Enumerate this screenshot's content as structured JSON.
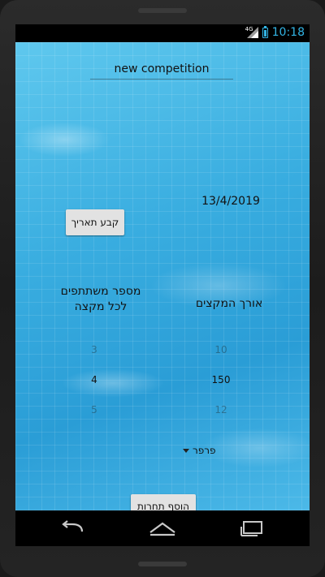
{
  "status_bar": {
    "network": "4G",
    "time": "10:18",
    "accent_color": "#33b5e5"
  },
  "form": {
    "title_value": "new competition",
    "set_date_label": "קבע תאריך",
    "date_value": "13/4/2019",
    "lanes_label": "מספר משתתפים לכל מקצה",
    "length_label": "אורך המקצים",
    "participants_picker": {
      "above": "3",
      "selected": "4",
      "below": "5"
    },
    "length_picker": {
      "above": "10",
      "selected": "150",
      "below": "12"
    },
    "stroke_spinner": {
      "selected": "פרפר"
    },
    "add_competition_label": "הוסף תחרות"
  },
  "nav_bar": {
    "icons": [
      "back-icon",
      "home-icon",
      "recent-apps-icon"
    ]
  }
}
